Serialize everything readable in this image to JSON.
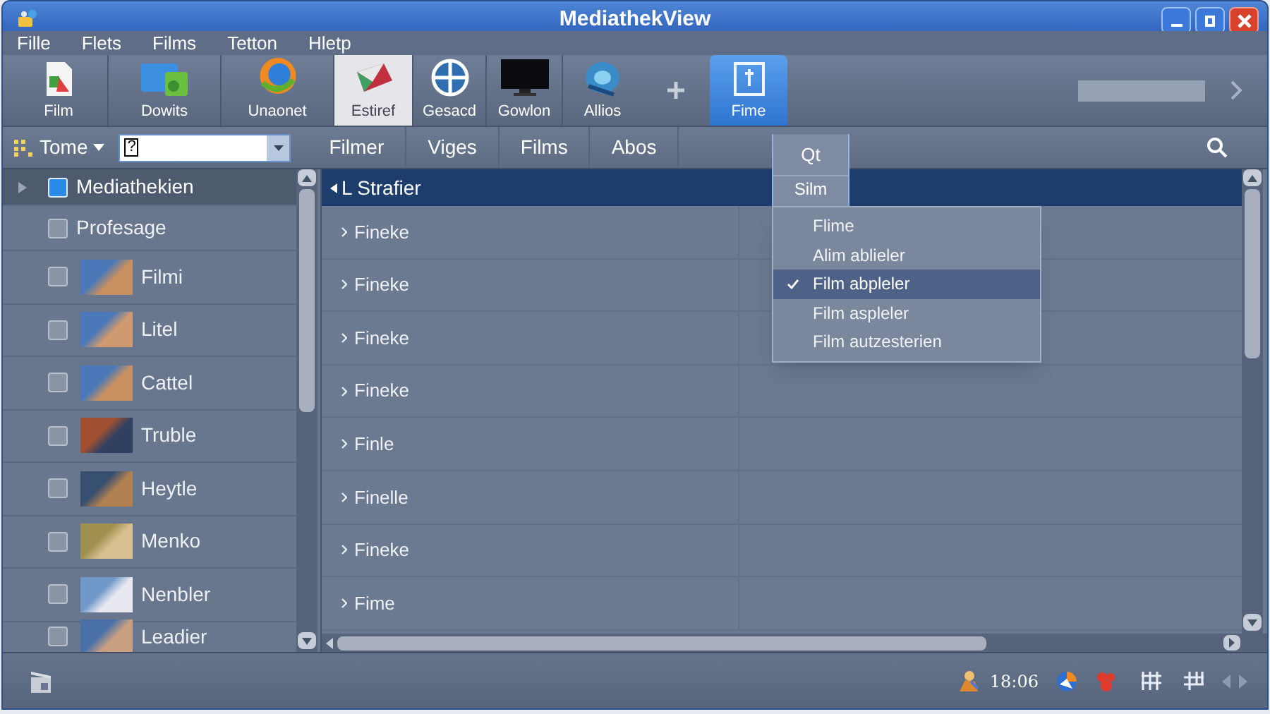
{
  "window": {
    "title": "MediathekView"
  },
  "menu": [
    "Fille",
    "Flets",
    "Films",
    "Tetton",
    "Hletp"
  ],
  "toolbar": [
    {
      "label": "Film",
      "selected": false
    },
    {
      "label": "Dowits",
      "selected": false
    },
    {
      "label": "Unaonet",
      "selected": false
    },
    {
      "label": "Estiref",
      "selected": true
    },
    {
      "label": "Gesacd",
      "selected": false
    },
    {
      "label": "Gowlon",
      "selected": false
    },
    {
      "label": "Allios",
      "selected": false
    },
    {
      "label": "Fime",
      "selected": true
    }
  ],
  "filter_bar": {
    "view_label": "Tome",
    "combo_value": "?",
    "tabs": [
      "Filmer",
      "Viges",
      "Films",
      "Abos"
    ]
  },
  "sidebar": {
    "items": [
      {
        "kind": "group",
        "label": "Mediathekien",
        "checked": true,
        "selected": true,
        "expanded": false
      },
      {
        "kind": "plain",
        "label": "Profesage",
        "checked": false,
        "selected": false
      },
      {
        "kind": "photo",
        "label": "Filmi",
        "checked": false,
        "selected": false
      },
      {
        "kind": "photo",
        "label": "Litel",
        "checked": false,
        "selected": false
      },
      {
        "kind": "photo",
        "label": "Cattel",
        "checked": false,
        "selected": false
      },
      {
        "kind": "photo",
        "label": "Truble",
        "checked": false,
        "selected": false
      },
      {
        "kind": "photo",
        "label": "Heytle",
        "checked": false,
        "selected": false
      },
      {
        "kind": "photo",
        "label": "Menko",
        "checked": false,
        "selected": false
      },
      {
        "kind": "photo",
        "label": "Nenbler",
        "checked": false,
        "selected": false
      },
      {
        "kind": "photo",
        "label": "Leadier",
        "checked": false,
        "selected": false
      }
    ]
  },
  "list": {
    "header": "L Strafier",
    "rows": [
      "Fineke",
      "Fineke",
      "Fineke",
      "Fineke",
      "Finle",
      "Finelle",
      "Fineke",
      "Fime"
    ]
  },
  "dropdown": {
    "button": "Qt",
    "heading": "Silm",
    "items": [
      {
        "label": "Flime",
        "checked": false,
        "selected": false
      },
      {
        "label": "Alim ablieler",
        "checked": false,
        "selected": false
      },
      {
        "label": "Film abpleler",
        "checked": true,
        "selected": true
      },
      {
        "label": "Film aspleler",
        "checked": false,
        "selected": false
      },
      {
        "label": "Film autzesterien",
        "checked": false,
        "selected": false
      }
    ]
  },
  "status_bar": {
    "time": "18:06"
  }
}
